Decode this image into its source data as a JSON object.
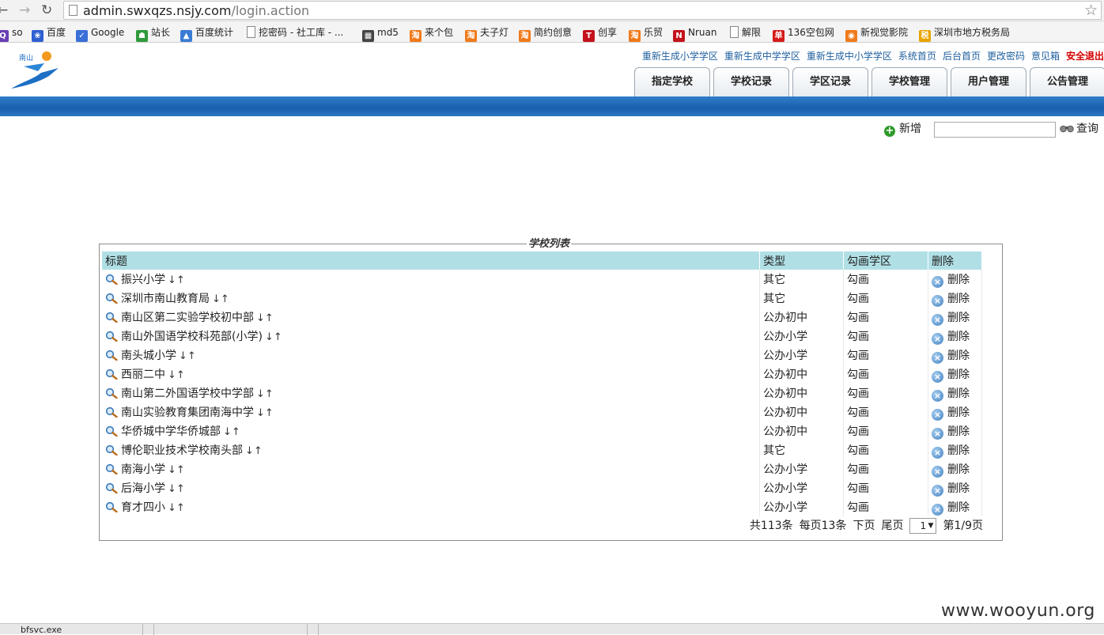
{
  "browser": {
    "url_host": "admin.swxqzs.nsjy.com",
    "url_path": "/login.action",
    "bookmarks": [
      {
        "label": "so",
        "icon": "search-icon",
        "color": "#6a3fb3"
      },
      {
        "label": "百度",
        "icon": "baidu-paw-icon",
        "color": "#2f5fd1"
      },
      {
        "label": "Google",
        "icon": "google-icon",
        "color": "#3a6fd8"
      },
      {
        "label": "站长",
        "icon": "cnzz-icon",
        "color": "#2e9a3c"
      },
      {
        "label": "百度统计",
        "icon": "chart-icon",
        "color": "#3a7bd5"
      },
      {
        "label": "挖密码 - 社工库 - ...",
        "icon": "page-icon",
        "color": "#ffffff"
      },
      {
        "label": "md5",
        "icon": "grid-icon",
        "color": "#444444"
      },
      {
        "label": "来个包",
        "icon": "taobao-icon",
        "color": "#f07a1a"
      },
      {
        "label": "夫子灯",
        "icon": "taobao-icon",
        "color": "#f07a1a"
      },
      {
        "label": "简约创意",
        "icon": "taobao-icon",
        "color": "#f07a1a"
      },
      {
        "label": "创享",
        "icon": "tmall-icon",
        "color": "#c4121b"
      },
      {
        "label": "乐贸",
        "icon": "taobao-icon",
        "color": "#f07a1a"
      },
      {
        "label": "Nruan",
        "icon": "n-icon",
        "color": "#c4121b"
      },
      {
        "label": "解限",
        "icon": "page-icon",
        "color": "#ffffff"
      },
      {
        "label": "136空包网",
        "icon": "dan-icon",
        "color": "#d41b1b"
      },
      {
        "label": "新视觉影院",
        "icon": "film-icon",
        "color": "#f07a1a"
      },
      {
        "label": "深圳市地方税务局",
        "icon": "tax-icon",
        "color": "#e8a400"
      }
    ]
  },
  "header": {
    "links": [
      {
        "label": "重新生成小学学区"
      },
      {
        "label": "重新生成中学学区"
      },
      {
        "label": "重新生成中小学学区"
      },
      {
        "label": "系统首页"
      },
      {
        "label": "后台首页"
      },
      {
        "label": "更改密码"
      },
      {
        "label": "意见箱"
      },
      {
        "label": "安全退出",
        "emphasis": true
      }
    ],
    "tabs": [
      "指定学校",
      "学校记录",
      "学区记录",
      "学校管理",
      "用户管理",
      "公告管理"
    ]
  },
  "toolbar": {
    "add_label": "新增",
    "search_value": "",
    "query_label": "查询"
  },
  "list": {
    "legend": "学校列表",
    "columns": [
      "标题",
      "类型",
      "勾画学区",
      "删除"
    ],
    "sort_arrows": "↓↑",
    "action_draw": "勾画",
    "action_delete": "删除",
    "rows": [
      {
        "title": "振兴小学",
        "type": "其它"
      },
      {
        "title": "深圳市南山教育局",
        "type": "其它"
      },
      {
        "title": "南山区第二实验学校初中部",
        "type": "公办初中"
      },
      {
        "title": "南山外国语学校科苑部(小学)",
        "type": "公办小学"
      },
      {
        "title": "南头城小学",
        "type": "公办小学"
      },
      {
        "title": "西丽二中",
        "type": "公办初中"
      },
      {
        "title": "南山第二外国语学校中学部",
        "type": "公办初中"
      },
      {
        "title": "南山实验教育集团南海中学",
        "type": "公办初中"
      },
      {
        "title": "华侨城中学华侨城部",
        "type": "公办初中"
      },
      {
        "title": "博伦职业技术学校南头部",
        "type": "其它"
      },
      {
        "title": "南海小学",
        "type": "公办小学"
      },
      {
        "title": "后海小学",
        "type": "公办小学"
      },
      {
        "title": "育才四小",
        "type": "公办小学"
      }
    ],
    "pager": {
      "total": "共113条",
      "per_page": "每页13条",
      "next": "下页",
      "last": "尾页",
      "current_page": "1",
      "page_of": "第1/9页"
    }
  },
  "watermark": "www.wooyun.org",
  "downloads": {
    "item": "bfsvc.exe"
  }
}
